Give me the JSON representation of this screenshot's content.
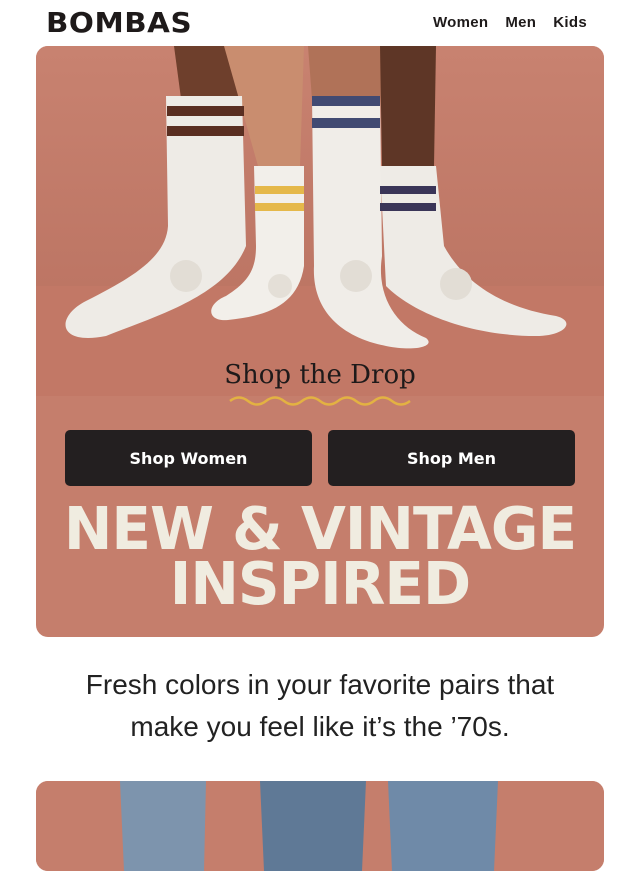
{
  "header": {
    "logo": "BOMBAS",
    "nav": [
      "Women",
      "Men",
      "Kids"
    ]
  },
  "hero": {
    "drop_title": "Shop the Drop",
    "buttons": {
      "women": "Shop Women",
      "men": "Shop Men"
    },
    "headline_line1": "NEW & VINTAGE",
    "headline_line2": "INSPIRED"
  },
  "body": {
    "copy_line1": "Fresh colors in your favorite pairs that",
    "copy_line2": "make you feel like it’s the ’70s."
  },
  "colors": {
    "hero_bg": "#c57e6c",
    "button_bg": "#231f20",
    "headline": "#f0ece0"
  }
}
